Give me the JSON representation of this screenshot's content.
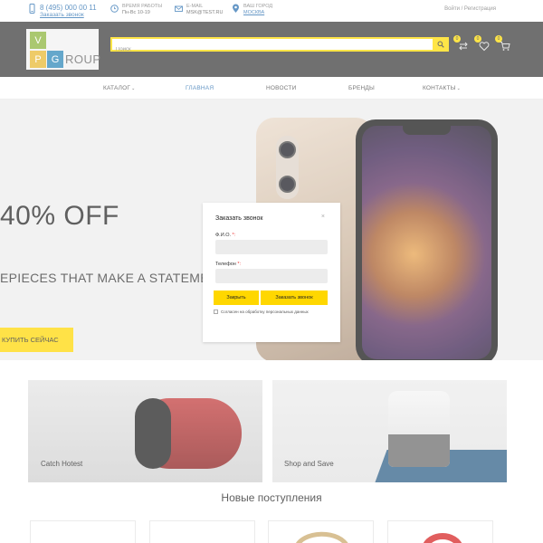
{
  "topbar": {
    "phone": "8 (495) 000 00 11",
    "callback_link": "Заказать звонок",
    "hours_label": "Время работы",
    "hours_value": "Пн-Вс 10-19",
    "email_label": "E-mail",
    "email_value": "msk@test.ru",
    "city_label": "Ваш город",
    "city_value": "Москва",
    "auth": "Войти / Регистрация"
  },
  "header": {
    "logo": {
      "v": "V",
      "p": "P",
      "g": "G",
      "rest": "ROUP"
    },
    "search": {
      "placeholder": "Поиск"
    },
    "badges": {
      "compare": "0",
      "favorites": "0",
      "cart": "0"
    }
  },
  "nav": {
    "items": [
      {
        "label": "Каталог",
        "has_dropdown": true
      },
      {
        "label": "Главная",
        "active": true
      },
      {
        "label": "Новости"
      },
      {
        "label": "Бренды"
      },
      {
        "label": "Контакты",
        "has_dropdown": true
      }
    ]
  },
  "hero": {
    "title": "40% OFF",
    "subtitle": "EPIECES THAT MAKE A STATEMENT",
    "button": "КУПИТЬ СЕЙЧАС"
  },
  "banners": [
    {
      "label": "Catch Hotest"
    },
    {
      "label": "Shop and Save"
    }
  ],
  "new_arrivals": {
    "title": "Новые поступления"
  },
  "modal": {
    "title": "Заказать звонок",
    "close": "×",
    "name_label": "Ф.И.О.",
    "phone_label": "Телефон",
    "required_mark": "*:",
    "close_button": "Закрыть",
    "submit_button": "Заказать звонок",
    "consent": "Согласен на обработку персональных данных"
  },
  "colors": {
    "accent": "#ffdc00",
    "header_bg": "#3a3a3a",
    "link": "#2a6fb0"
  }
}
